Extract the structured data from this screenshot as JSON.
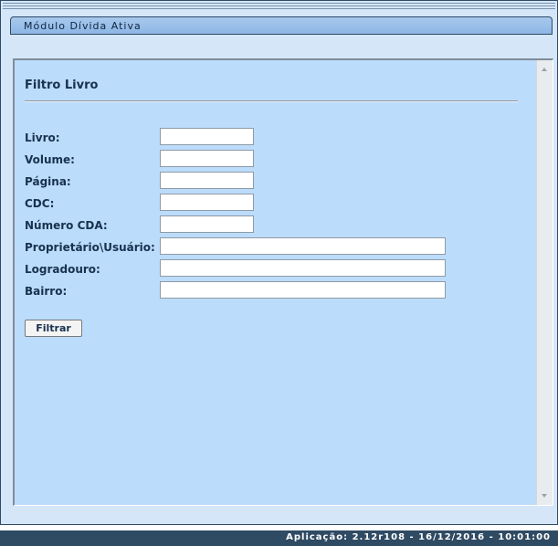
{
  "module": {
    "title": "Módulo Dívida Ativa"
  },
  "filter": {
    "title": "Filtro Livro",
    "fields": [
      {
        "label": "Livro:",
        "value": ""
      },
      {
        "label": "Volume:",
        "value": ""
      },
      {
        "label": "Página:",
        "value": ""
      },
      {
        "label": "CDC:",
        "value": ""
      },
      {
        "label": "Número CDA:",
        "value": ""
      },
      {
        "label": "Proprietário\\Usuário:",
        "value": ""
      },
      {
        "label": "Logradouro:",
        "value": ""
      },
      {
        "label": "Bairro:",
        "value": ""
      }
    ],
    "submit_label": "Filtrar"
  },
  "status": {
    "text": "Aplicação: 2.12r108 - 16/12/2016 - 10:01:00"
  },
  "icons": {
    "scroll_up": "scroll-up-arrow-icon",
    "scroll_down": "scroll-down-arrow-icon"
  },
  "colors": {
    "panel": "#bcdcfc",
    "status_bar": "#2f4a63",
    "label_text": "#17324f"
  }
}
